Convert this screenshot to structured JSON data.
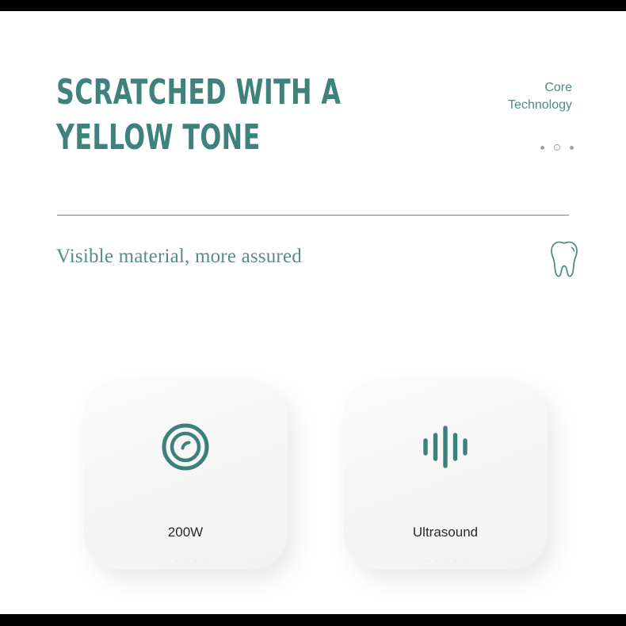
{
  "header": {
    "headline": "SCRATCHED WITH A\nYELLOW TONE",
    "kicker": "Core\nTechnology",
    "pagination": [
      {
        "name": "dot-1",
        "state": "filled"
      },
      {
        "name": "dot-2",
        "state": "hollow"
      },
      {
        "name": "dot-3",
        "state": "filled"
      }
    ]
  },
  "subtitle": {
    "text": "Visible material, more assured",
    "icon": "tooth-icon"
  },
  "cards": [
    {
      "icon": "concentric-circles-icon",
      "label": "200W",
      "dots": 5
    },
    {
      "icon": "waveform-icon",
      "label": "Ultrasound",
      "dots": 5
    }
  ],
  "colors": {
    "teal": "#3f827b",
    "teal_light": "#4d8b83",
    "subtitle": "#5d8a86",
    "divider": "#5c8e8a",
    "label": "#26292b",
    "dot": "#9aa4a3",
    "card_bg": "#f6f6f6",
    "letterbox": "#000000"
  }
}
